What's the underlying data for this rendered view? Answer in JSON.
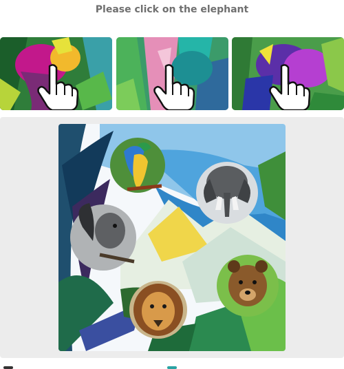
{
  "challenge": {
    "instruction": "Please click on the elephant"
  },
  "icons": {
    "example_hand": "pointing-hand-cursor-icon",
    "footer_left": "logo-icon",
    "footer_mid": "info-icon"
  },
  "colors": {
    "instruction_text": "#6f6f6f",
    "panel_background": "#ececec",
    "page_background": "#ffffff"
  }
}
